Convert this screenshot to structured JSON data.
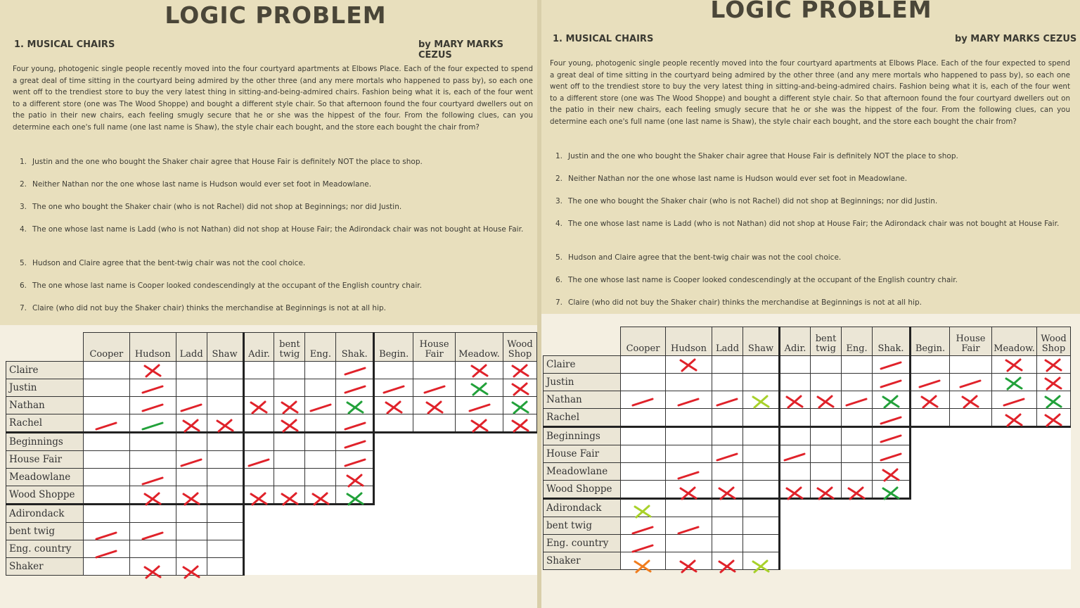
{
  "title": "LOGIC PROBLEM",
  "puzzle_name": "1. MUSICAL CHAIRS",
  "byline": "by MARY MARKS CEZUS",
  "intro": "Four young, photogenic single people recently moved into the four courtyard apartments at Elbows Place. Each of the four expected to spend a great deal of time sitting in the courtyard being admired by the other three (and any mere mortals who happened to pass by), so each one went off to the trendiest store to buy the very latest thing in sitting-and-being-admired chairs. Fashion being what it is, each of the four went to a different store (one was The Wood Shoppe) and bought a different style chair. So that afternoon found the four courtyard dwellers out on the patio in their new chairs, each feeling smugly secure that he or she was the hippest of the four. From the following clues, can you determine each one's full name (one last name is Shaw), the style chair each bought, and the store each bought the chair from?",
  "clues": [
    {
      "num": "1.",
      "text": "Justin and the one who bought the Shaker chair agree that House Fair is definitely NOT the place to shop."
    },
    {
      "num": "2.",
      "text": "Neither Nathan nor the one whose last name is Hudson would ever set foot in Meadowlane."
    },
    {
      "num": "3.",
      "text": "The one who bought the Shaker chair (who is not Rachel) did not shop at Beginnings; nor did Justin."
    },
    {
      "num": "4.",
      "text": "The one whose last name is Ladd (who is not Nathan) did not shop at House Fair; the Adirondack chair was not bought at House Fair."
    },
    {
      "num": "5.",
      "text": "Hudson and Claire agree that the bent-twig chair was not the cool choice."
    },
    {
      "num": "6.",
      "text": "The one whose last name is Cooper looked condescendingly at the occupant of the English country chair."
    },
    {
      "num": "7.",
      "text": "Claire (who did not buy the Shaker chair) thinks the merchandise at Beginnings is not at all hip."
    }
  ],
  "grid": {
    "columns": [
      "Cooper",
      "Hudson",
      "Ladd",
      "Shaw",
      "Adir.",
      "bent twig",
      "Eng.",
      "Shak.",
      "Begin.",
      "House Fair",
      "Meadow.",
      "Wood Shop"
    ],
    "rows": [
      "Claire",
      "Justin",
      "Nathan",
      "Rachel",
      "Beginnings",
      "House Fair",
      "Meadowlane",
      "Wood Shoppe",
      "Adirondack",
      "bent twig",
      "Eng. country",
      "Shaker"
    ]
  },
  "mark_colors": {
    "red": "#e0222a",
    "green": "#22a13a",
    "lime": "#a8d12a",
    "orange": "#f07d1f"
  },
  "panels": [
    "left-copy",
    "right-copy"
  ]
}
